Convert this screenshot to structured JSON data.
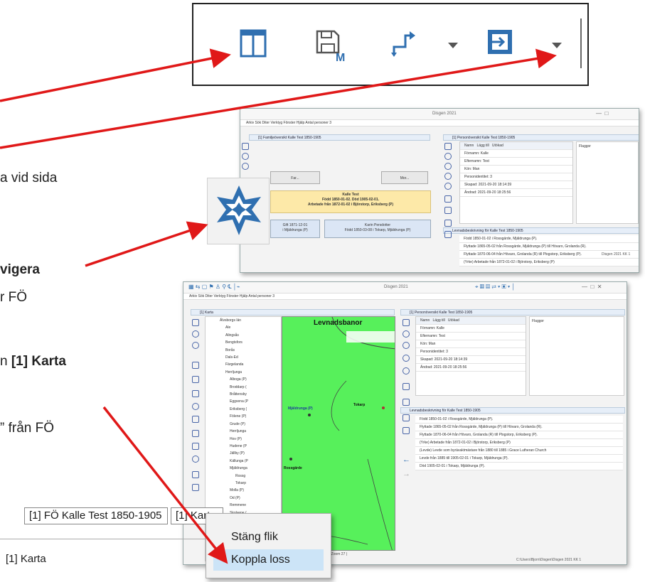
{
  "text_fragments": {
    "line1": "a vid sida",
    "line2": "vigera",
    "line3": "r FÖ",
    "line4_prefix": "n ",
    "line4_bold": "[1] Karta",
    "line5": "” från FÖ"
  },
  "toolbar_zoom": {
    "icons": [
      "table-icon",
      "save-m-icon",
      "swap-arrows-icon",
      "dropdown-icon",
      "dock-swap-icon",
      "dropdown-icon"
    ]
  },
  "window_back": {
    "title": "Disgen 2021",
    "menu": "Arkiv  Sök  Diter  Verktyg  Fönster  Hjälp  Antal personer 3",
    "family_pane_title": "[1] Familjeöversikt Kalle Test 1850-1905",
    "father_btn": "Far...",
    "mother_btn": "Mor...",
    "person_name": "Kalle Test",
    "person_born_died": "Född 1850-01-02. Död 1905-02-01.",
    "person_work": "Arbetade från 1872-01-02 i Björstorp, Eriksberg (P)",
    "spouse_left": "Gift 1871-12-01",
    "spouse_left2": "i Mjäldrunga (P)",
    "spouse_name": "Karin Persdotter",
    "spouse_born": "Född 1850-03-08 i Tokarp, Mjäldrunga (P)",
    "person_pane_title": "[1] Personöversikt Kalle Test 1850-1905",
    "col_name": "Namn",
    "add_btn": "Lägg till",
    "expand_btn": "Utökad",
    "flags": "Flaggor",
    "rows": [
      "Förnamn: Kalle",
      "Efternamn: Test",
      "Kön: Man",
      "Personidentitet: 3",
      "Skapad: 2021-09-20 18:14:39",
      "Ändrad: 2021-09-20 18:25:56"
    ],
    "life_title": "Levnadsbeskrivning för Kalle Test 1850-1905",
    "life_rows": [
      "Född 1850-01-02 i Rossgärde, Mjäldrunga (P).",
      "Flyttade 1865-05-02 från Rossgärde, Mjäldrunga (P) till Hövaro, Grolanda (R).",
      "Flyttade 1870-06-04 från Hövaro, Grolanda (R) till Plogstorp, Eriksberg (P).",
      "(Yrke) Arbetade från 1872-01-02 i Björstorp, Eriksberg (P)"
    ],
    "status_side": "Disgen 2021 KK 1"
  },
  "window_front": {
    "title": "Disgen 2021",
    "menu": "Arkiv  Sök  Diter  Verktyg  Fönster  Hjälp  Antal personer 3",
    "map_pane_title": "[1] Karta",
    "map_title": "Levnadsbanor",
    "tree_items": [
      "Älvsborgs län",
      "Ale",
      "Alingsås",
      "Bengtsfors",
      "Borås",
      "Dals-Ed",
      "Färgelanda",
      "Herrljunga",
      "Alboga (P)",
      "Broddarp (",
      "Bråttensby",
      "Eggvena (P",
      "Eriksberg (",
      "Fölene (P)",
      "Grude (P)",
      "Herrljunga",
      "Hov (P)",
      "Hudene (P",
      "Jällby (P)",
      "Källunga (P",
      "Mjäldrunga",
      "Rossg",
      "Tokarp",
      "Molla (P)",
      "Od (P)",
      "Remmene",
      "Skolvene (",
      "Södra Björk"
    ],
    "map_labels": [
      "Mjäldrunga (P)",
      "Tokarp",
      "Rossgärde"
    ],
    "map_footer": "[1] | Zoom 27 |",
    "person_pane_title": "[1] Personöversikt Kalle Test 1850-1905",
    "col_name": "Namn",
    "add_btn": "Lägg till",
    "expand_btn": "Utökad",
    "flags": "Flaggor",
    "rows": [
      "Förnamn: Kalle",
      "Efternamn: Test",
      "Kön: Man",
      "Personidentitet: 3",
      "Skapad: 2021-09-20 18:14:39",
      "Ändrad: 2021-09-20 18:25:56"
    ],
    "life_title": "Levnadsbeskrivning för Kalle Test 1850-1905",
    "life_rows": [
      "Född 1850-01-02 i Rossgärde, Mjäldrunga (P).",
      "Flyttade 1865-05-02 från Rossgärde, Mjäldrunga (P) till Hövaro, Grolanda (R).",
      "Flyttade 1870-06-04 från Hövaro, Grolanda (R) till Plogstorp, Eriksberg (P).",
      "(Yrke) Arbetade från 1872-01-02 i Björstorp, Eriksberg (P)",
      "(Levde) Levde som byrävaktmästare från 1880 till 1885 i Grace Lutheran Church",
      "Levde från 1885 till 1905-02-01 i Tokarp, Mjäldrunga (P).",
      "Död 1905-02-01 i Tokarp, Mjäldrunga (P)."
    ],
    "status": "C:\\Users\\Bjorn\\Disgen\\Disgen 2021 KK 1"
  },
  "tabs": {
    "tab1": "[1] FÖ Kalle Test 1850-1905",
    "tab2": "[1] Karta",
    "bottom_label": "[1] Karta"
  },
  "context_menu": {
    "items": [
      "Stäng flik",
      "Koppla loss"
    ]
  },
  "colors": {
    "arrow": "#e01818",
    "icon_blue": "#2f6fb0",
    "map_green": "#57f05b"
  }
}
